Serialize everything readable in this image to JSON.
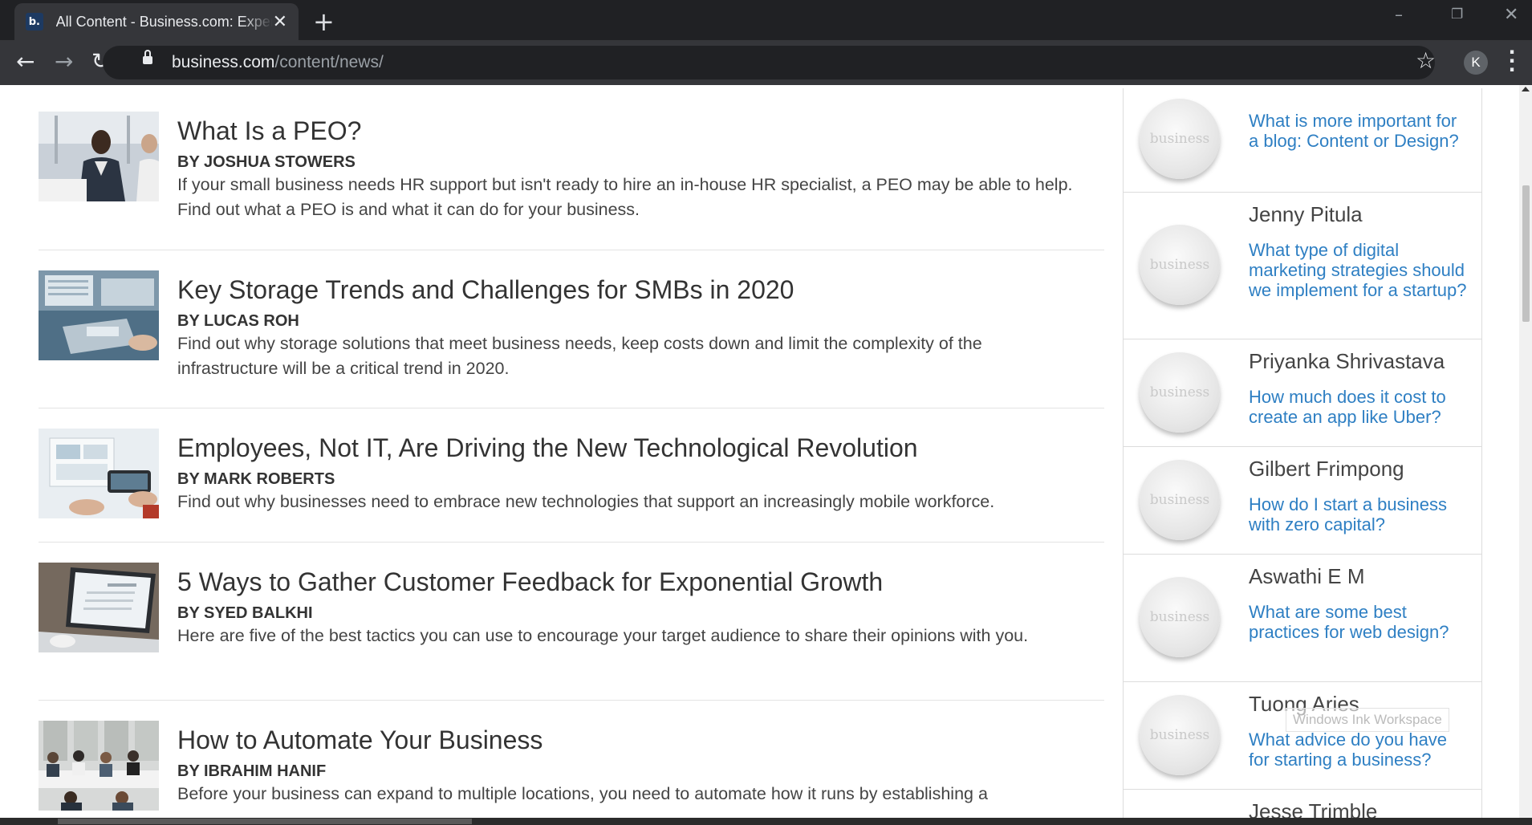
{
  "browser": {
    "tab_title": "All Content - Business.com: Expert",
    "favicon_letter": "b.",
    "tab_close_glyph": "✕",
    "new_tab_glyph": "+",
    "url_host": "business.com",
    "url_path": "/content/news/",
    "profile_initial": "K"
  },
  "articles": [
    {
      "title": "What Is a PEO?",
      "author": "BY JOSHUA STOWERS",
      "description": "If your small business needs HR support but isn't ready to hire an in-house HR specialist, a PEO may be able to help. Find out what a PEO is and what it can do for your business."
    },
    {
      "title": "Key Storage Trends and Challenges for SMBs in 2020",
      "author": "BY LUCAS ROH",
      "description": "Find out why storage solutions that meet business needs, keep costs down and limit the complexity of the infrastructure will be a critical trend in 2020."
    },
    {
      "title": "Employees, Not IT, Are Driving the New Technological Revolution",
      "author": "BY MARK ROBERTS",
      "description": "Find out why businesses need to embrace new technologies that support an increasingly mobile workforce."
    },
    {
      "title": "5 Ways to Gather Customer Feedback for Exponential Growth",
      "author": "BY SYED BALKHI",
      "description": "Here are five of the best tactics you can use to encourage your target audience to share their opinions with you."
    },
    {
      "title": "How to Automate Your Business",
      "author": "BY IBRAHIM HANIF",
      "description": "Before your business can expand to multiple locations, you need to automate how it runs by establishing a"
    }
  ],
  "sidebar": {
    "avatar_word": "business",
    "questions": [
      {
        "name": "",
        "question": "What is more important for a blog: Content or Design?"
      },
      {
        "name": "Jenny Pitula",
        "question": "What type of digital marketing strategies should we implement for a startup?"
      },
      {
        "name": "Priyanka Shrivastava",
        "question": "How much does it cost to create an app like Uber?"
      },
      {
        "name": "Gilbert Frimpong",
        "question": "How do I start a business with zero capital?"
      },
      {
        "name": "Aswathi E M",
        "question": "What are some best practices for web design?"
      },
      {
        "name": "Tuong Aries",
        "question": "What advice do you have for starting a business?"
      },
      {
        "name": "Jesse Trimble",
        "question": ""
      }
    ]
  },
  "overlay": {
    "watermark": "Windows Ink Workspace"
  }
}
